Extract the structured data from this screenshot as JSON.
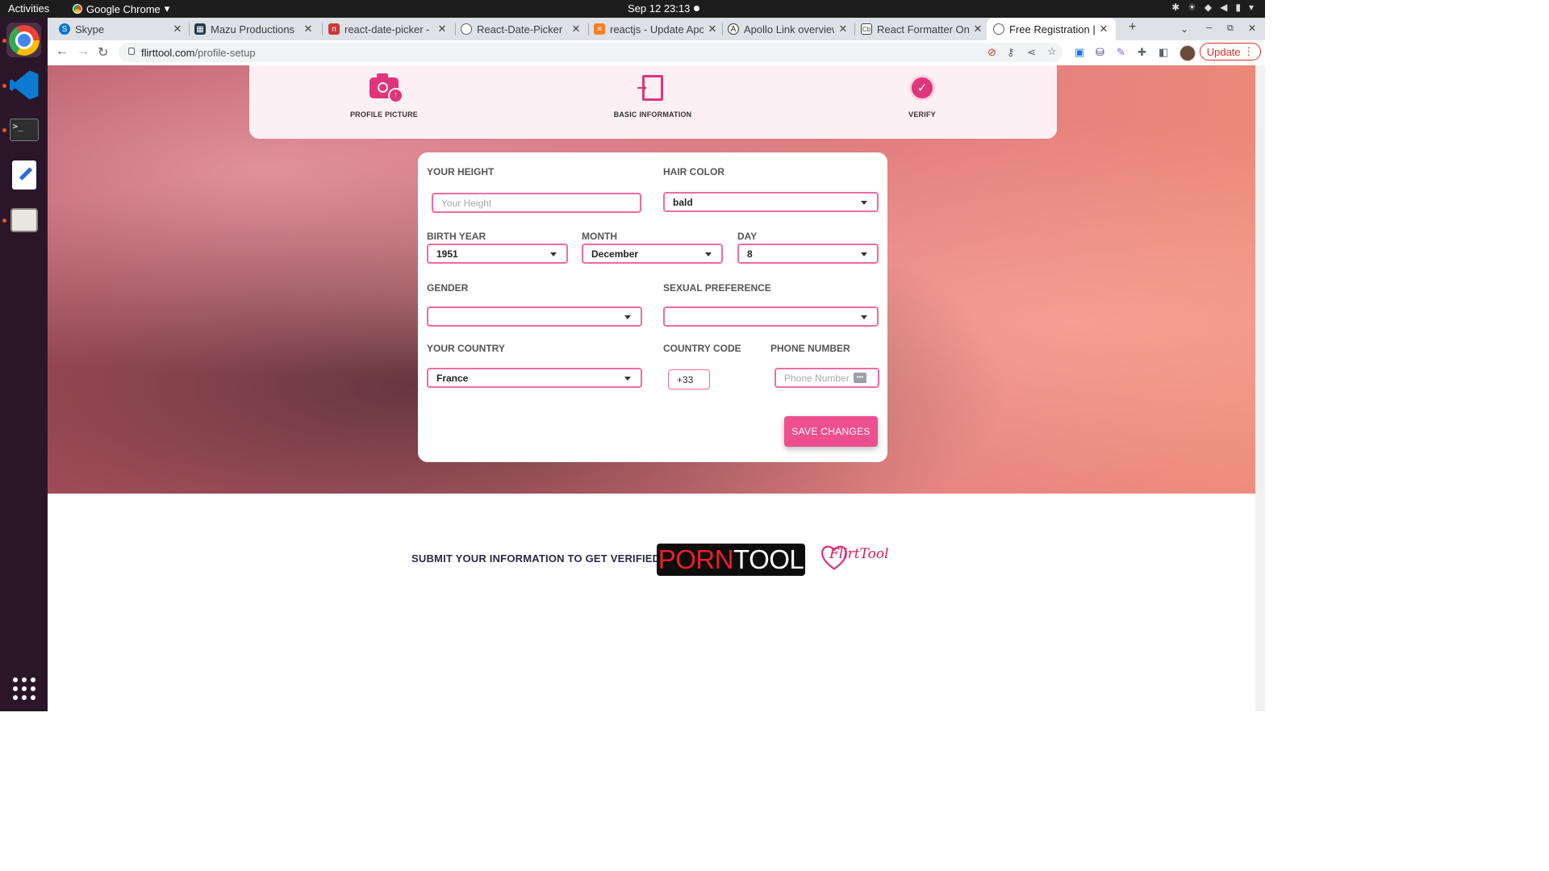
{
  "topbar": {
    "activities": "Activities",
    "app_name": "Google Chrome",
    "clock": "Sep 12  23:13"
  },
  "browser": {
    "tabs": [
      {
        "title": "Skype",
        "icon": "skype-icon",
        "color": "#0078d4"
      },
      {
        "title": "Mazu Productions",
        "icon": "mazu-icon",
        "color": "#1f3b4d"
      },
      {
        "title": "react-date-picker - np",
        "icon": "npm-icon",
        "color": "#cb3837"
      },
      {
        "title": "React-Date-Picker",
        "icon": "globe-icon",
        "color": "#5f6368"
      },
      {
        "title": "reactjs - Update Apo",
        "icon": "stackoverflow-icon",
        "color": "#f48024"
      },
      {
        "title": "Apollo Link overview",
        "icon": "apollo-icon",
        "color": "#333333"
      },
      {
        "title": "React Formatter On",
        "icon": "cb-icon",
        "color": "#444444"
      },
      {
        "title": "Free Registration | L",
        "icon": "globe-icon",
        "color": "#5f6368",
        "active": true
      }
    ],
    "url_domain": "flirttool.com",
    "url_path": "/profile-setup",
    "update_label": "Update"
  },
  "steps": [
    {
      "label": "PROFILE PICTURE",
      "icon": "camera-upload-icon"
    },
    {
      "label": "BASIC INFORMATION",
      "icon": "sign-in-document-icon"
    },
    {
      "label": "VERIFY",
      "icon": "check-circle-icon"
    }
  ],
  "form": {
    "height_label": "YOUR HEIGHT",
    "height_placeholder": "Your Height",
    "height_value": "",
    "hair_label": "HAIR COLOR",
    "hair_value": "bald",
    "birth_year_label": "BIRTH YEAR",
    "birth_year_value": "1951",
    "month_label": "MONTH",
    "month_value": "December",
    "day_label": "DAY",
    "day_value": "8",
    "gender_label": "GENDER",
    "gender_value": "",
    "preference_label": "SEXUAL PREFERENCE",
    "preference_value": "",
    "country_label": "YOUR COUNTRY",
    "country_value": "France",
    "code_label": "COUNTRY CODE",
    "code_value": "+33",
    "phone_label": "PHONE NUMBER",
    "phone_placeholder": "Phone Number",
    "save_label": "SAVE CHANGES"
  },
  "footer": {
    "submit_text": "SUBMIT YOUR INFORMATION TO GET VERIFIED",
    "porntool_part1": "PORN",
    "porntool_part2": "TOOL",
    "flirttool_word": "FlirtTool"
  },
  "colors": {
    "accent": "#ee4f8f",
    "field_border": "#ef6ba0",
    "icon_pink": "#e0357b"
  }
}
